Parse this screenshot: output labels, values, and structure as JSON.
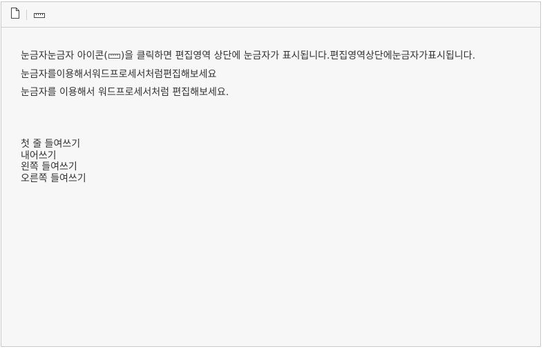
{
  "toolbar": {
    "icons": [
      "new-document-icon",
      "ruler-icon"
    ]
  },
  "content": {
    "para1_before": "눈금자눈금자 아이콘(",
    "para1_after": ")을 클릭하면 편집영역 상단에 눈금자가 표시됩니다.편집영역상단에눈금자가표시됩니다.",
    "para2": "눈금자를이용해서워드프로세서처럼편집해보세요",
    "para3": "눈금자를 이용해서 워드프로세서처럼 편집해보세요."
  },
  "indent_list": {
    "items": [
      "첫 줄 들여쓰기",
      "내어쓰기",
      "왼쪽 들여쓰기",
      "오른쪽 들여쓰기"
    ]
  },
  "colors": {
    "background": "#f7f7f7",
    "border": "#c9c9c9",
    "text": "#333333"
  }
}
